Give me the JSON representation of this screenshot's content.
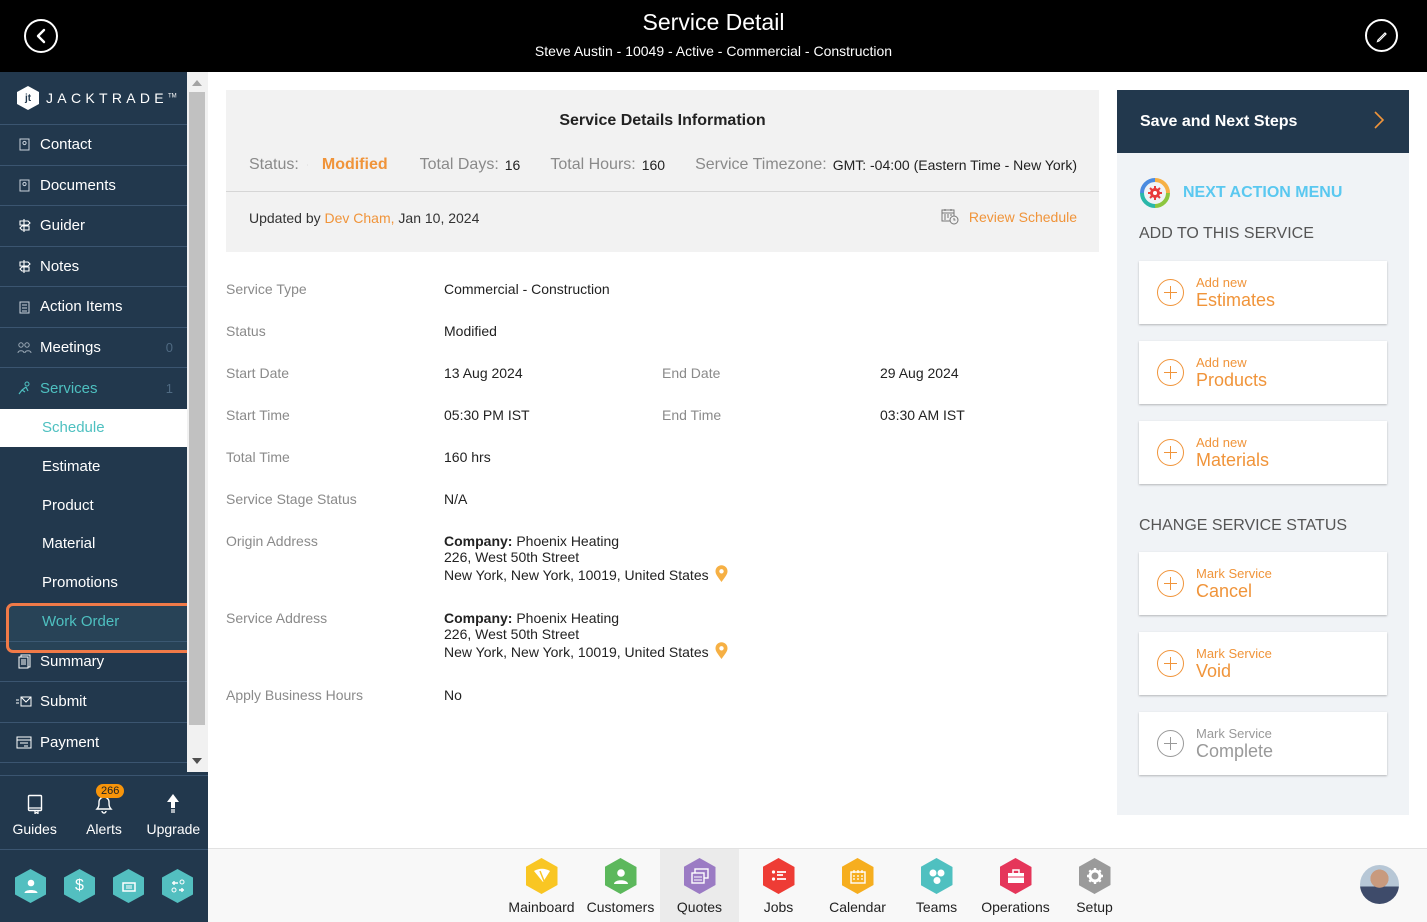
{
  "header": {
    "title": "Service Detail",
    "subtitle": "Steve Austin - 10049 - Active - Commercial - Construction",
    "back_icon": "chevron-left-circle-icon",
    "edit_icon": "pencil-circle-icon"
  },
  "sidebar": {
    "logo_text": "JACKTRADE",
    "logo_tm": "TM",
    "items": [
      {
        "label": "Contact",
        "icon": "contact-book-icon"
      },
      {
        "label": "Documents",
        "icon": "document-book-icon"
      },
      {
        "label": "Guider",
        "icon": "signpost-icon"
      },
      {
        "label": "Notes",
        "icon": "signpost-icon"
      },
      {
        "label": "Action Items",
        "icon": "clipboard-icon"
      },
      {
        "label": "Meetings",
        "icon": "meeting-icon",
        "count": "0"
      },
      {
        "label": "Services",
        "icon": "services-icon",
        "count": "1"
      }
    ],
    "sub_items": [
      {
        "label": "Schedule"
      },
      {
        "label": "Estimate"
      },
      {
        "label": "Product"
      },
      {
        "label": "Material"
      },
      {
        "label": "Promotions"
      },
      {
        "label": "Work Order"
      }
    ],
    "items_after": [
      {
        "label": "Summary",
        "icon": "summary-icon"
      },
      {
        "label": "Submit",
        "icon": "submit-icon"
      },
      {
        "label": "Payment",
        "icon": "payment-icon"
      }
    ],
    "bottom": {
      "guides": "Guides",
      "alerts": "Alerts",
      "alerts_badge": "266",
      "upgrade": "Upgrade"
    },
    "quick_apps": [
      "person-icon",
      "dollar-icon",
      "money-transfer-icon",
      "workflow-icon"
    ]
  },
  "info": {
    "title": "Service Details Information",
    "status_label": "Status:",
    "status_value": "Modified",
    "total_days_label": "Total Days:",
    "total_days_value": "16",
    "total_hours_label": "Total Hours:",
    "total_hours_value": "160",
    "timezone_label": "Service Timezone:",
    "timezone_value": "GMT: -04:00 (Eastern Time - New York)",
    "updated_prefix": "Updated by",
    "updated_by": "Dev Cham,",
    "updated_date": "Jan 10, 2024",
    "review_schedule": "Review Schedule"
  },
  "details": {
    "service_type_label": "Service Type",
    "service_type_value": "Commercial - Construction",
    "status_label": "Status",
    "status_value": "Modified",
    "start_date_label": "Start Date",
    "start_date_value": "13 Aug 2024",
    "end_date_label": "End Date",
    "end_date_value": "29 Aug 2024",
    "start_time_label": "Start Time",
    "start_time_value": "05:30 PM IST",
    "end_time_label": "End Time",
    "end_time_value": "03:30 AM IST",
    "total_time_label": "Total Time",
    "total_time_value": "160 hrs",
    "stage_status_label": "Service Stage Status",
    "stage_status_value": "N/A",
    "origin_label": "Origin Address",
    "origin": {
      "company_label": "Company:",
      "company": "Phoenix Heating",
      "line1": "226, West 50th Street",
      "line2": "New York, New York, 10019, United States"
    },
    "service_addr_label": "Service Address",
    "service_addr": {
      "company_label": "Company:",
      "company": "Phoenix Heating",
      "line1": "226, West 50th Street",
      "line2": "New York, New York, 10019, United States"
    },
    "business_hours_label": "Apply Business Hours",
    "business_hours_value": "No"
  },
  "right_panel": {
    "save_next": "Save and Next Steps",
    "next_action_menu": "NEXT ACTION MENU",
    "add_section": "ADD TO THIS SERVICE",
    "add_cards": [
      {
        "line1": "Add new",
        "line2": "Estimates"
      },
      {
        "line1": "Add new",
        "line2": "Products"
      },
      {
        "line1": "Add new",
        "line2": "Materials"
      }
    ],
    "status_section": "CHANGE SERVICE STATUS",
    "status_cards": [
      {
        "line1": "Mark Service",
        "line2": "Cancel",
        "enabled": true
      },
      {
        "line1": "Mark Service",
        "line2": "Void",
        "enabled": true
      },
      {
        "line1": "Mark Service",
        "line2": "Complete",
        "enabled": false
      }
    ]
  },
  "appbar": {
    "apps": [
      {
        "label": "Mainboard",
        "color": "#f9c623"
      },
      {
        "label": "Customers",
        "color": "#5cb85c"
      },
      {
        "label": "Quotes",
        "color": "#9b7bc4"
      },
      {
        "label": "Jobs",
        "color": "#ee3c35"
      },
      {
        "label": "Calendar",
        "color": "#f6ae1f"
      },
      {
        "label": "Teams",
        "color": "#4fc0c0"
      },
      {
        "label": "Operations",
        "color": "#e5365a"
      },
      {
        "label": "Setup",
        "color": "#9a9a9a"
      }
    ],
    "current": "Quotes"
  },
  "colors": {
    "accent_orange": "#f0943a",
    "sidebar_bg": "#22384d",
    "teal": "#4ec0c0",
    "highlight_border": "#f07a48"
  }
}
